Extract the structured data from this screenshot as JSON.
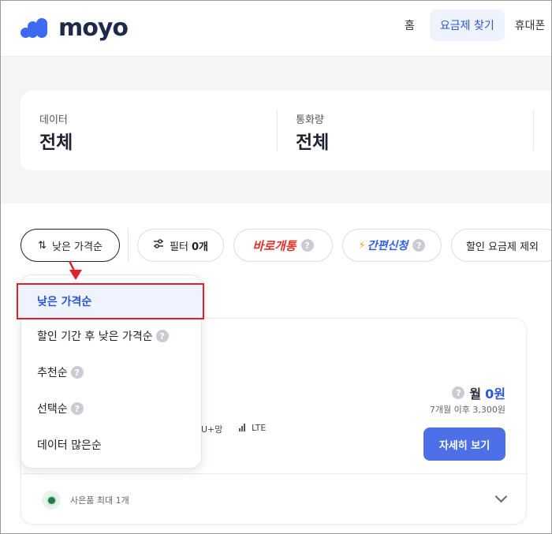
{
  "header": {
    "brand": "moyo",
    "nav": [
      "홈",
      "요금제 찾기",
      "휴대폰"
    ]
  },
  "filters": [
    {
      "label": "데이터",
      "value": "전체"
    },
    {
      "label": "통화량",
      "value": "전체"
    }
  ],
  "chips": {
    "sort_label": "낮은 가격순",
    "filter_label": "필터",
    "filter_count": "0개",
    "instant_open": "바로개통",
    "easy_apply": "간편신청",
    "exclude_discount": "할인 요금제 제외"
  },
  "dropdown": {
    "options": [
      "낮은 가격순",
      "할인 기간 후 낮은 가격순",
      "추천순",
      "선택순",
      "데이터 많은순"
    ]
  },
  "plan": {
    "price_prefix": "월",
    "price": "0원",
    "price_after": "7개월 이후 3,300원",
    "network": "U+망",
    "tech": "LTE",
    "detail_button": "자세히 보기",
    "gift": "사은품 최대 1개"
  },
  "colors": {
    "brand_blue": "#3d6af0",
    "accent_red": "#e0202a",
    "button_blue": "#4d6fe8"
  }
}
